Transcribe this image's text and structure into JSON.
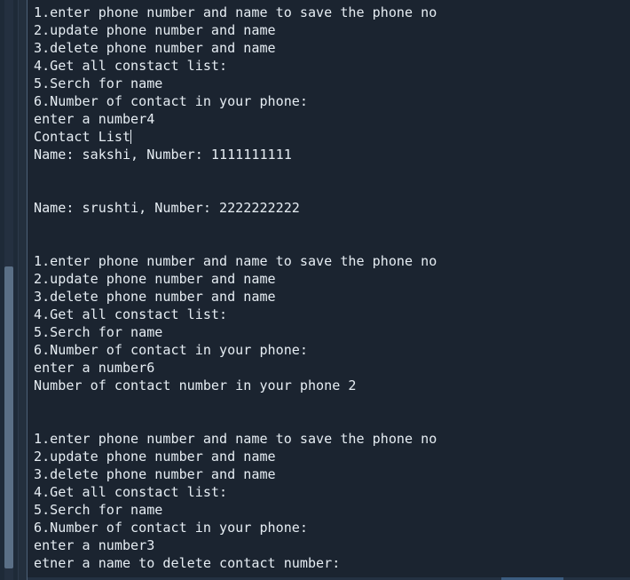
{
  "console": {
    "lines": [
      "1.enter phone number and name to save the phone no",
      "2.update phone number and name",
      "3.delete phone number and name",
      "4.Get all constact list:",
      "5.Serch for name",
      "6.Number of contact in your phone:",
      "enter a number4",
      "Contact List",
      "Name: sakshi, Number: 1111111111",
      "",
      "",
      "Name: srushti, Number: 2222222222",
      "",
      "",
      "1.enter phone number and name to save the phone no",
      "2.update phone number and name",
      "3.delete phone number and name",
      "4.Get all constact list:",
      "5.Serch for name",
      "6.Number of contact in your phone:",
      "enter a number6",
      "Number of contact number in your phone 2",
      "",
      "",
      "1.enter phone number and name to save the phone no",
      "2.update phone number and name",
      "3.delete phone number and name",
      "4.Get all constact list:",
      "5.Serch for name",
      "6.Number of contact in your phone:",
      "enter a number3",
      "etner a name to delete contact number:"
    ]
  }
}
